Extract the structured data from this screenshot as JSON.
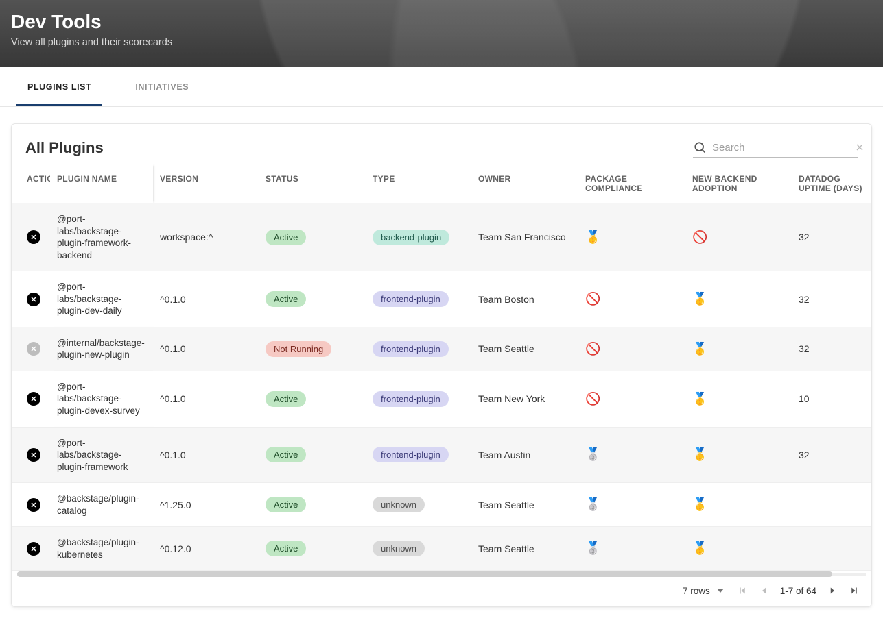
{
  "header": {
    "title": "Dev Tools",
    "subtitle": "View all plugins and their scorecards"
  },
  "tabs": [
    {
      "label": "PLUGINS LIST",
      "active": true
    },
    {
      "label": "INITIATIVES",
      "active": false
    }
  ],
  "panel": {
    "title": "All Plugins",
    "search_placeholder": "Search"
  },
  "columns": {
    "actions": "ACTIONS",
    "plugin_name": "PLUGIN NAME",
    "version": "VERSION",
    "status": "STATUS",
    "type": "TYPE",
    "owner": "OWNER",
    "package_compliance": "PACKAGE COMPLIANCE",
    "new_backend_adoption": "NEW BACKEND ADOPTION",
    "datadog_uptime": "DATADOG UPTIME (DAYS)"
  },
  "rows": [
    {
      "action_enabled": true,
      "name": "@port-labs/backstage-plugin-framework-backend",
      "version": "workspace:^",
      "status": {
        "label": "Active",
        "variant": "green"
      },
      "type": {
        "label": "backend-plugin",
        "variant": "mint"
      },
      "owner": "Team San Francisco",
      "package_compliance": "🥇",
      "new_backend_adoption": "🚫",
      "uptime": "32"
    },
    {
      "action_enabled": true,
      "name": "@port-labs/backstage-plugin-dev-daily",
      "version": "^0.1.0",
      "status": {
        "label": "Active",
        "variant": "green"
      },
      "type": {
        "label": "frontend-plugin",
        "variant": "lav"
      },
      "owner": "Team Boston",
      "package_compliance": "🚫",
      "new_backend_adoption": "🥇",
      "uptime": "32"
    },
    {
      "action_enabled": false,
      "name": "@internal/backstage-plugin-new-plugin",
      "version": "^0.1.0",
      "status": {
        "label": "Not Running",
        "variant": "red"
      },
      "type": {
        "label": "frontend-plugin",
        "variant": "lav"
      },
      "owner": "Team Seattle",
      "package_compliance": "🚫",
      "new_backend_adoption": "🥇",
      "uptime": "32"
    },
    {
      "action_enabled": true,
      "name": "@port-labs/backstage-plugin-devex-survey",
      "version": "^0.1.0",
      "status": {
        "label": "Active",
        "variant": "green"
      },
      "type": {
        "label": "frontend-plugin",
        "variant": "lav"
      },
      "owner": "Team New York",
      "package_compliance": "🚫",
      "new_backend_adoption": "🥇",
      "uptime": "10"
    },
    {
      "action_enabled": true,
      "name": "@port-labs/backstage-plugin-framework",
      "version": "^0.1.0",
      "status": {
        "label": "Active",
        "variant": "green"
      },
      "type": {
        "label": "frontend-plugin",
        "variant": "lav"
      },
      "owner": "Team Austin",
      "package_compliance": "🥈",
      "new_backend_adoption": "🥇",
      "uptime": "32"
    },
    {
      "action_enabled": true,
      "name": "@backstage/plugin-catalog",
      "version": "^1.25.0",
      "status": {
        "label": "Active",
        "variant": "green"
      },
      "type": {
        "label": "unknown",
        "variant": "grey"
      },
      "owner": "Team Seattle",
      "package_compliance": "🥈",
      "new_backend_adoption": "🥇",
      "uptime": ""
    },
    {
      "action_enabled": true,
      "name": "@backstage/plugin-kubernetes",
      "version": "^0.12.0",
      "status": {
        "label": "Active",
        "variant": "green"
      },
      "type": {
        "label": "unknown",
        "variant": "grey"
      },
      "owner": "Team Seattle",
      "package_compliance": "🥈",
      "new_backend_adoption": "🥇",
      "uptime": ""
    }
  ],
  "pagination": {
    "rows_label": "7 rows",
    "range": "1-7 of 64"
  }
}
